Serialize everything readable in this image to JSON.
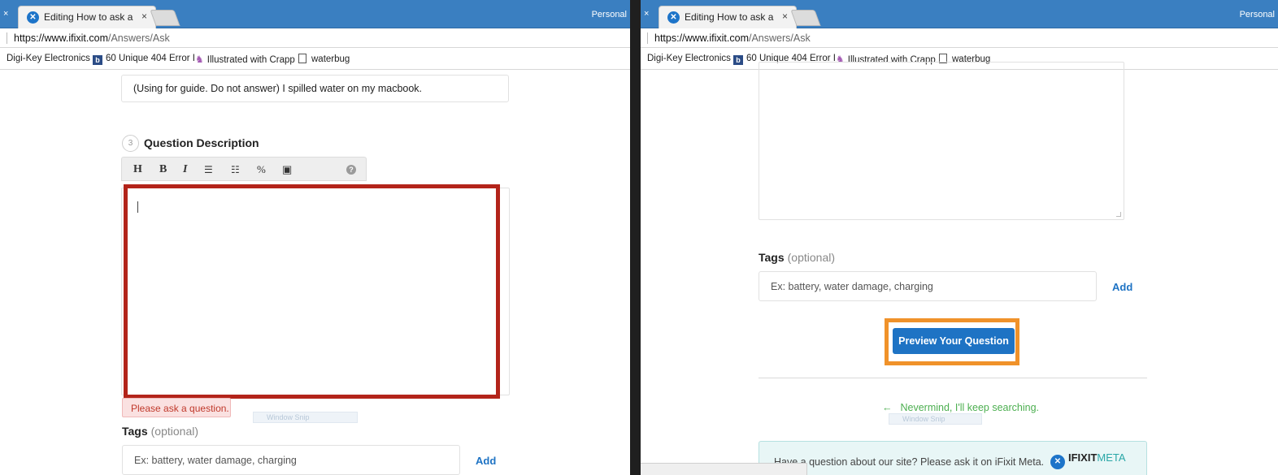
{
  "browser": {
    "tab_title": "Editing How to ask a que",
    "tab_close": "×",
    "tab_strip_close": "×",
    "favicon": "ifixit-icon",
    "profile": "Personal",
    "url_host": "https://www.ifixit.com",
    "url_path": "/Answers/Ask",
    "bookmarks": [
      {
        "label": "Digi-Key Electronics",
        "icon": ""
      },
      {
        "label": "60 Unique 404 Error I",
        "icon": "b-icon"
      },
      {
        "label": "Illustrated with Crapp",
        "icon": "mascot-icon"
      },
      {
        "label": "waterbug",
        "icon": "page-icon"
      }
    ]
  },
  "left": {
    "question_title": "(Using for guide. Do not answer) I spilled water on my macbook.",
    "step_number": "3",
    "step_label": "Question Description",
    "toolbar": {
      "heading": "H",
      "bold": "B",
      "italic": "I",
      "bullet_list": "☰",
      "numbered_list": "☷",
      "link": "%",
      "image": "▣",
      "help": "?"
    },
    "error": "Please ask a question.",
    "snap_text": "Window Snip",
    "tags_label": "Tags",
    "tags_optional": "(optional)",
    "tags_placeholder": "Ex: battery, water damage, charging",
    "add": "Add"
  },
  "right": {
    "tags_label": "Tags",
    "tags_optional": "(optional)",
    "tags_placeholder": "Ex: battery, water damage, charging",
    "add": "Add",
    "preview_button": "Preview Your Question",
    "nevermind": "Nevermind, I'll keep searching.",
    "nevermind_arrow": "←",
    "snap_text": "Window Snip",
    "meta_text": "Have a question about our site? Please ask it on iFixit Meta.",
    "meta_logo_main": "IFIXIT",
    "meta_logo_sub": "META"
  },
  "colors": {
    "highlight_red": "#b3241a",
    "highlight_orange": "#f0922a",
    "link_blue": "#1e73c4",
    "success_green": "#4caf50",
    "tab_bar_blue": "#3a7fc1"
  }
}
